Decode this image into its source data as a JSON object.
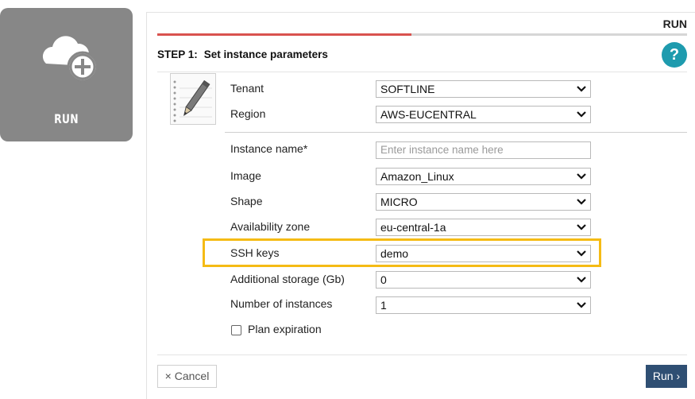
{
  "tile": {
    "label": "RUN",
    "icon": "cloud-add-icon"
  },
  "panel": {
    "title": "RUN",
    "progress_fraction": 0.48,
    "step_number": "STEP 1:",
    "step_title": "Set instance parameters",
    "help_label": "?",
    "colors": {
      "accent": "#d9534f",
      "help": "#1e9bae",
      "primary": "#2f4f73",
      "highlight": "#f5bb15"
    }
  },
  "form": {
    "tenant": {
      "label": "Tenant",
      "value": "SOFTLINE"
    },
    "region": {
      "label": "Region",
      "value": "AWS-EUCENTRAL"
    },
    "instance_name": {
      "label": "Instance name*",
      "placeholder": "Enter instance name here",
      "value": ""
    },
    "image": {
      "label": "Image",
      "value": "Amazon_Linux"
    },
    "shape": {
      "label": "Shape",
      "value": "MICRO"
    },
    "availability_zone": {
      "label": "Availability zone",
      "value": "eu-central-1a"
    },
    "ssh_keys": {
      "label": "SSH keys",
      "value": "demo"
    },
    "additional_storage": {
      "label": "Additional storage (Gb)",
      "value": "0"
    },
    "number_of_instances": {
      "label": "Number of instances",
      "value": "1"
    },
    "plan_expiration": {
      "label": "Plan expiration",
      "checked": false
    }
  },
  "footer": {
    "cancel_label": "× Cancel",
    "run_label": "Run ›"
  }
}
